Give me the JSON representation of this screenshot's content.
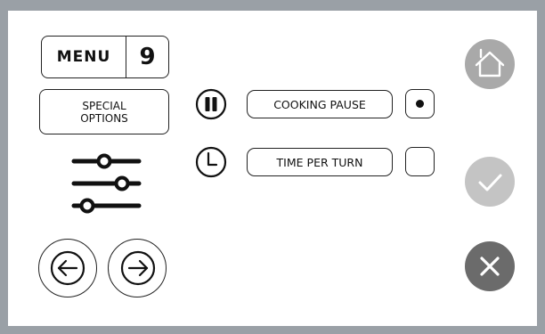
{
  "menu": {
    "label": "MENU",
    "number": "9"
  },
  "special_options": {
    "line1": "SPECIAL",
    "line2": "OPTIONS"
  },
  "options": [
    {
      "label": "COOKING PAUSE",
      "icon": "pause-icon",
      "checked": true
    },
    {
      "label": "TIME PER TURN",
      "icon": "clock-icon",
      "checked": false
    }
  ],
  "nav": {
    "prev_icon": "arrow-left-icon",
    "next_icon": "arrow-right-icon"
  },
  "actions": {
    "home_icon": "home-icon",
    "confirm_icon": "check-icon",
    "cancel_icon": "close-icon"
  },
  "colors": {
    "frame": "#9aa0a6",
    "home_button": "#a9a9a9",
    "confirm_button": "#c4c4c4",
    "cancel_button": "#6b6b6b"
  }
}
